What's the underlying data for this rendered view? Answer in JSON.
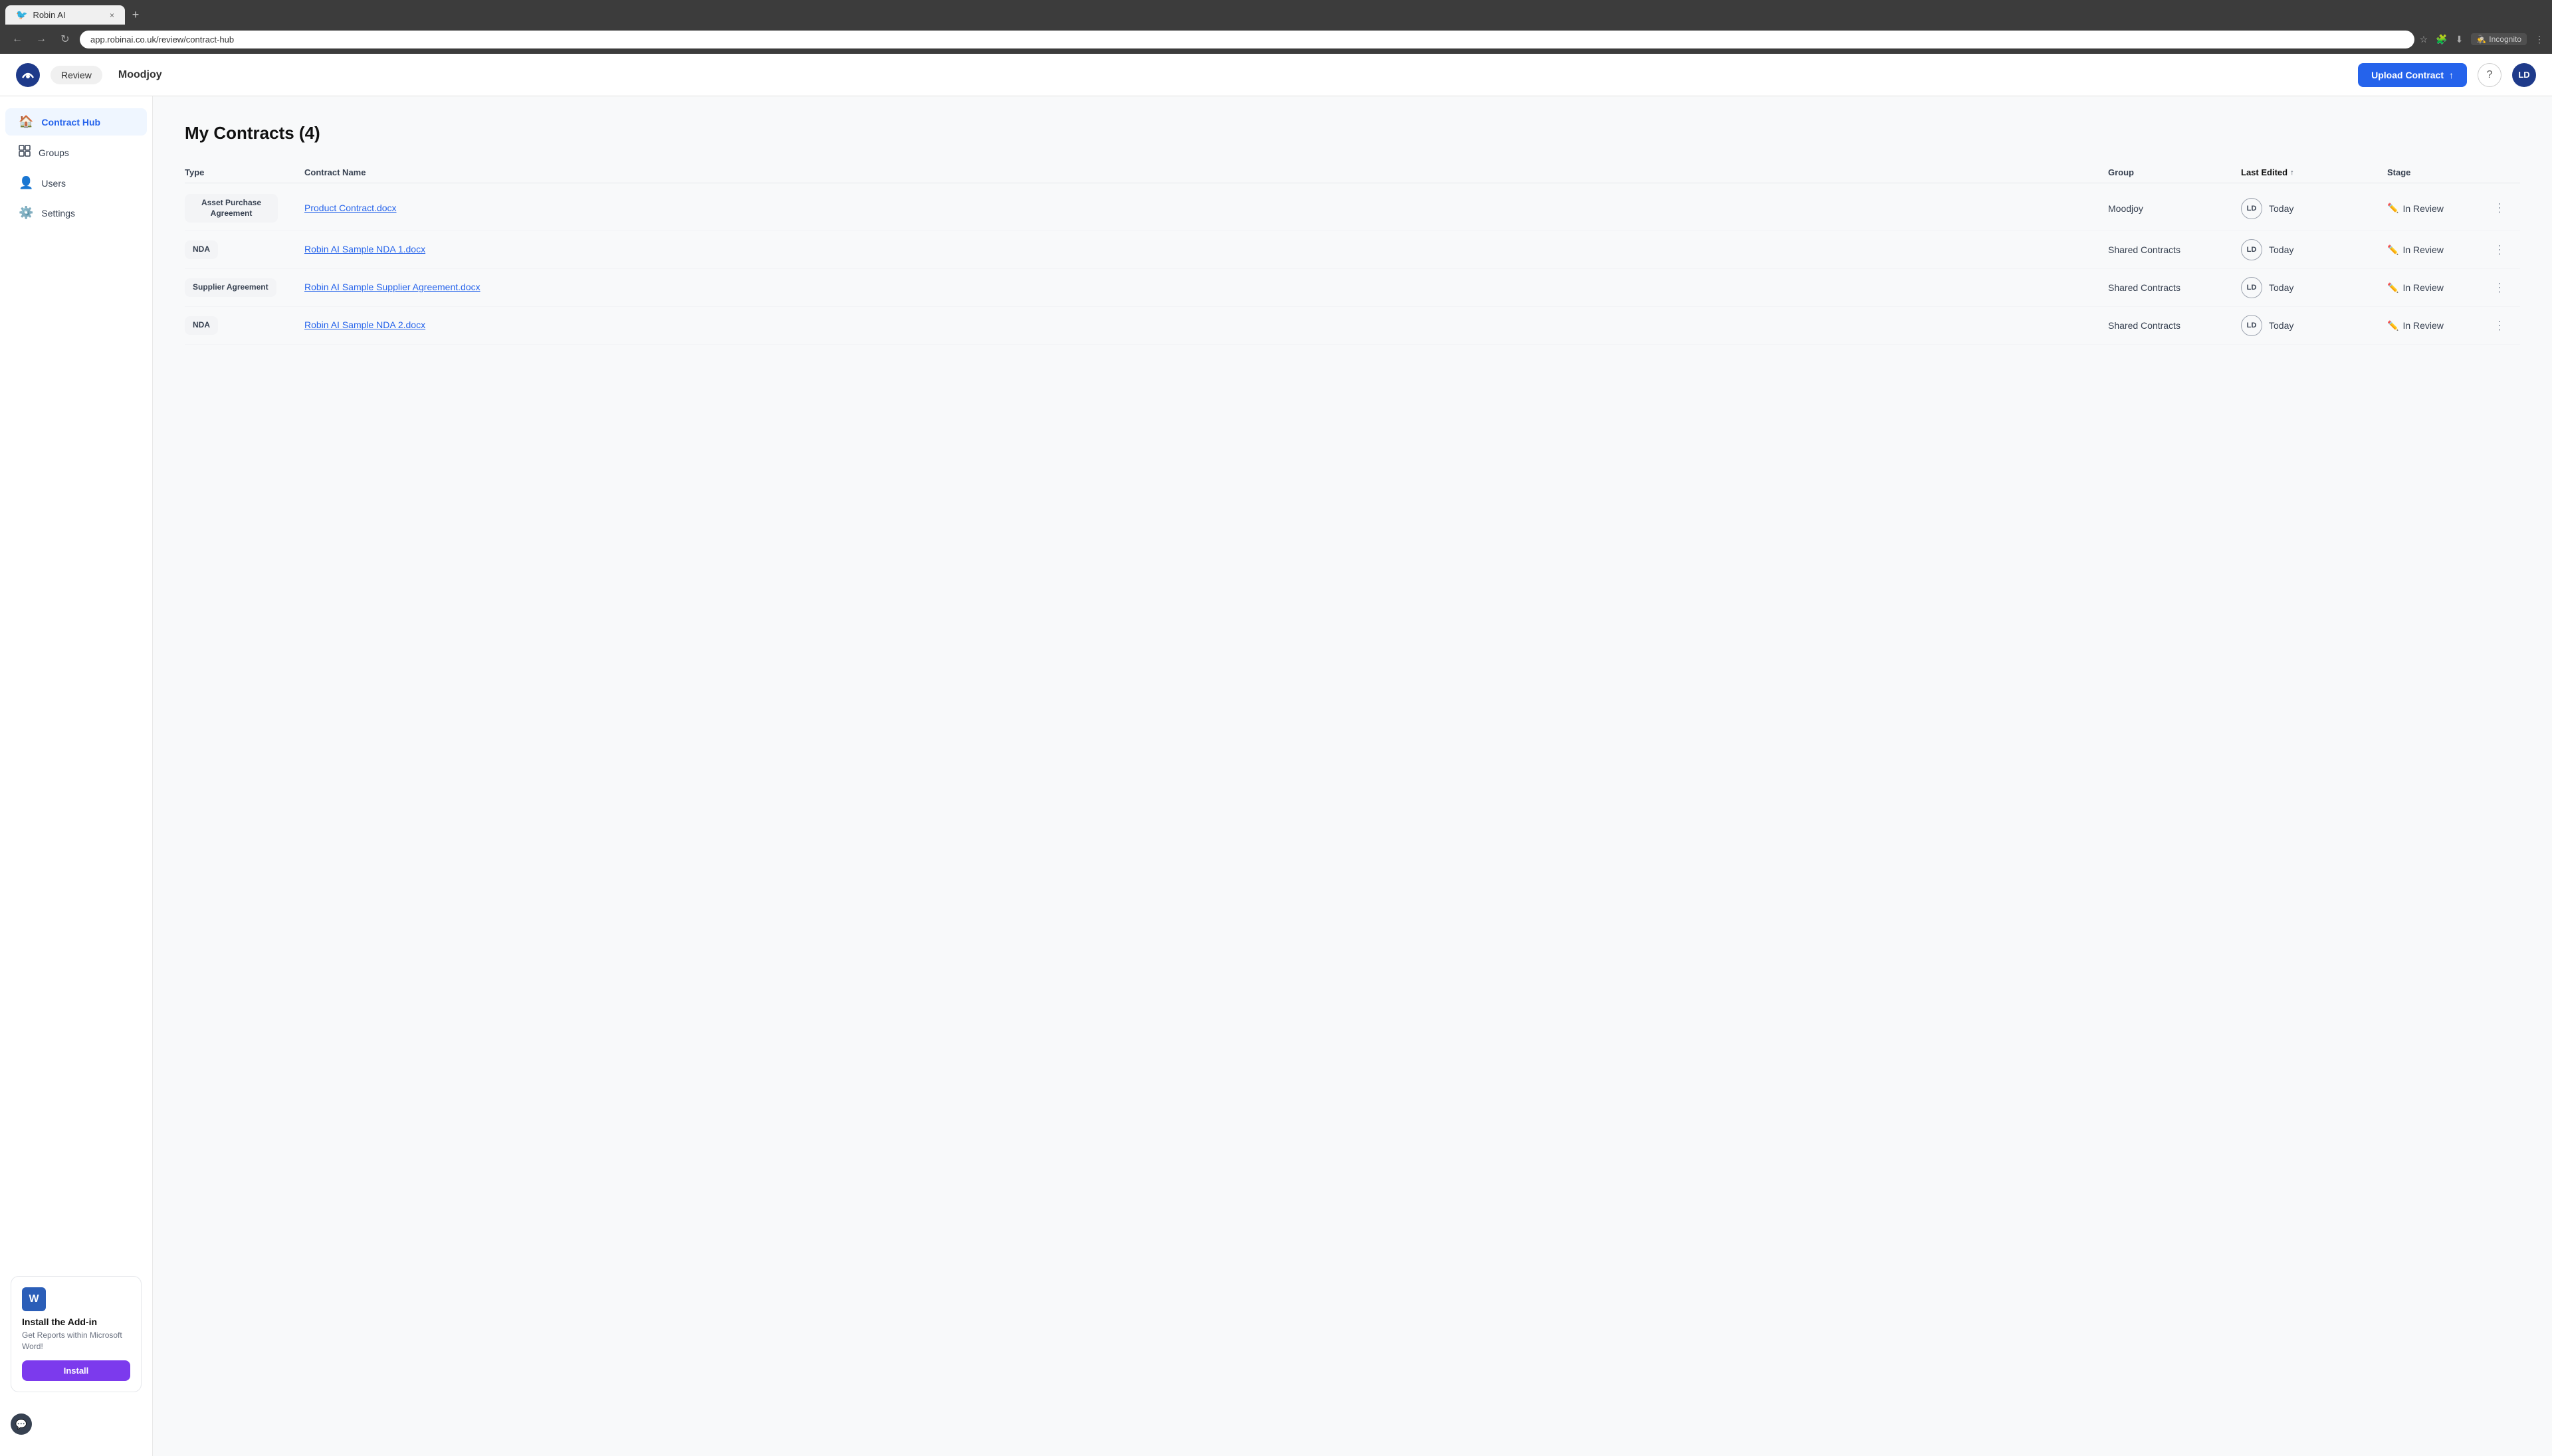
{
  "browser": {
    "tab_label": "Robin AI",
    "tab_close": "×",
    "tab_new": "+",
    "address": "app.robinai.co.uk/review/contract-hub",
    "incognito_label": "Incognito"
  },
  "header": {
    "brand": "Moodjoy",
    "review_label": "Review",
    "upload_label": "Upload Contract",
    "avatar_initials": "LD"
  },
  "sidebar": {
    "items": [
      {
        "id": "contract-hub",
        "label": "Contract Hub",
        "icon": "🏠",
        "active": true
      },
      {
        "id": "groups",
        "label": "Groups",
        "icon": "⊞",
        "active": false
      },
      {
        "id": "users",
        "label": "Users",
        "icon": "👤",
        "active": false
      },
      {
        "id": "settings",
        "label": "Settings",
        "icon": "⚙️",
        "active": false
      }
    ],
    "addon": {
      "icon": "W",
      "title": "Install the Add-in",
      "description": "Get Reports within Microsoft Word!",
      "install_label": "Install"
    },
    "chat_icon": "⚙"
  },
  "main": {
    "title": "My Contracts (4)",
    "table": {
      "columns": [
        {
          "id": "type",
          "label": "Type"
        },
        {
          "id": "contract_name",
          "label": "Contract Name"
        },
        {
          "id": "group",
          "label": "Group"
        },
        {
          "id": "last_edited",
          "label": "Last Edited",
          "sorted": true
        },
        {
          "id": "stage",
          "label": "Stage"
        },
        {
          "id": "actions",
          "label": ""
        }
      ],
      "rows": [
        {
          "type": "Asset Purchase Agreement",
          "contract_name": "Product Contract.docx",
          "group": "Moodjoy",
          "avatar": "LD",
          "last_edited": "Today",
          "stage": "In Review"
        },
        {
          "type": "NDA",
          "contract_name": "Robin AI Sample NDA 1.docx",
          "group": "Shared Contracts",
          "avatar": "LD",
          "last_edited": "Today",
          "stage": "In Review"
        },
        {
          "type": "Supplier Agreement",
          "contract_name": "Robin AI Sample Supplier Agreement.docx",
          "group": "Shared Contracts",
          "avatar": "LD",
          "last_edited": "Today",
          "stage": "In Review"
        },
        {
          "type": "NDA",
          "contract_name": "Robin AI Sample NDA 2.docx",
          "group": "Shared Contracts",
          "avatar": "LD",
          "last_edited": "Today",
          "stage": "In Review"
        }
      ]
    }
  }
}
